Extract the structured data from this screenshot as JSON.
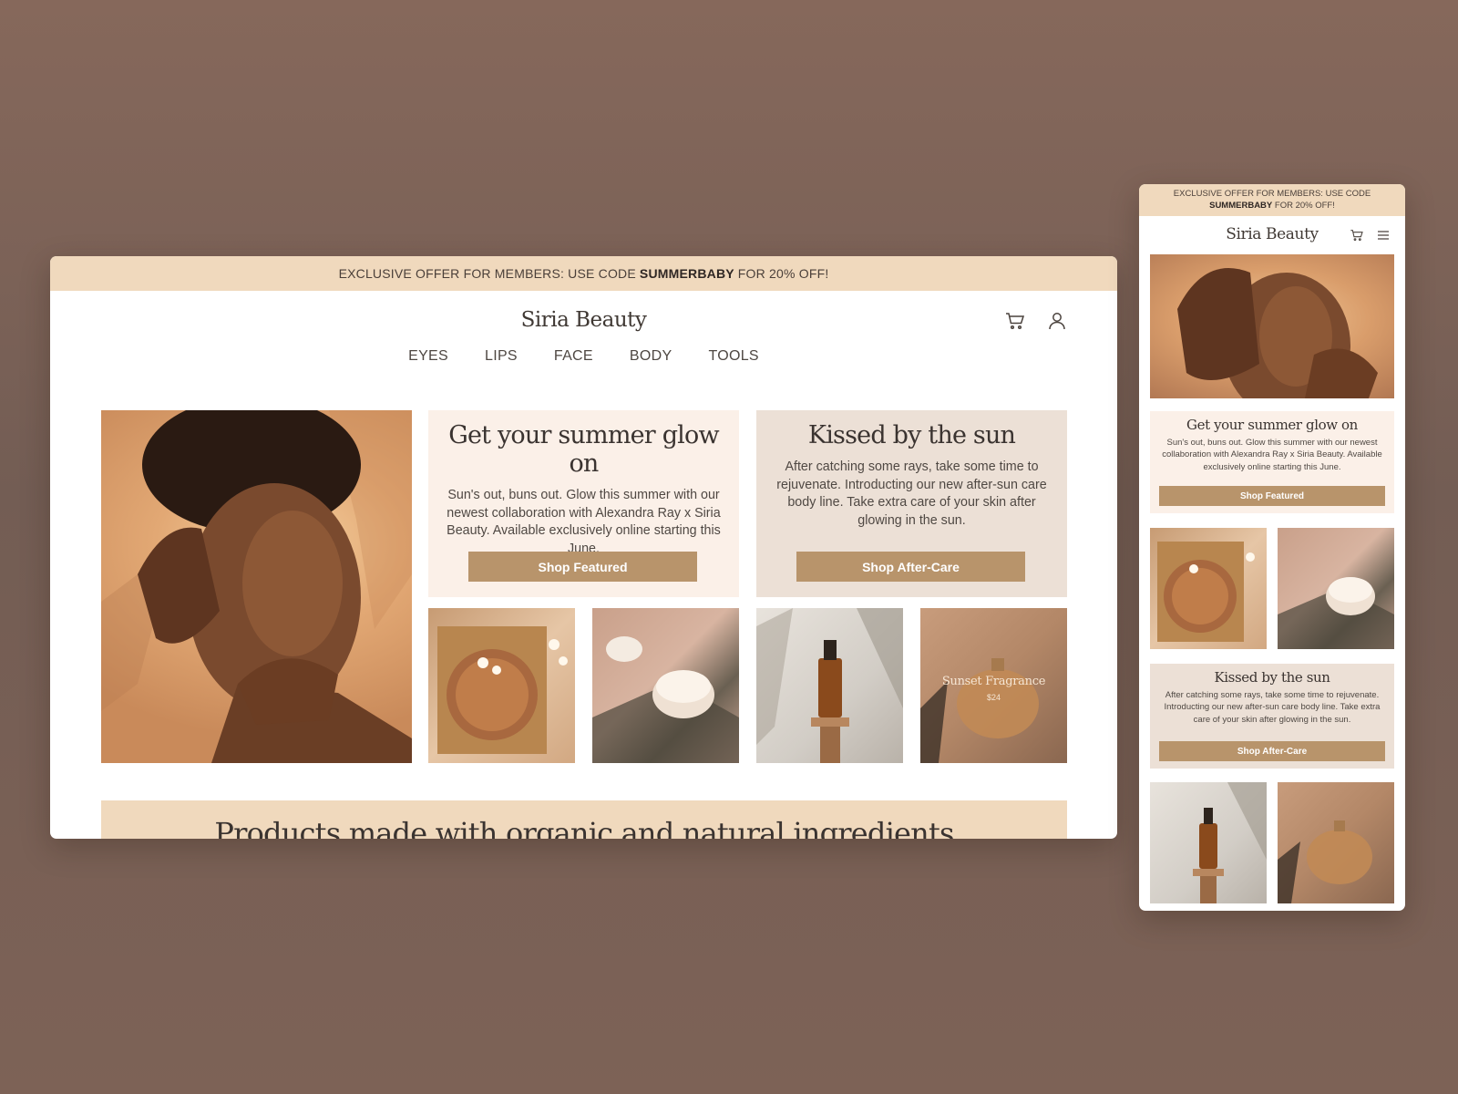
{
  "desktop": {
    "promo": {
      "prefix": "EXCLUSIVE OFFER FOR MEMBERS: USE CODE",
      "code": "SUMMERBABY",
      "suffix": "FOR 20% OFF!"
    },
    "logo": "Siria Beauty",
    "nav": [
      "EYES",
      "LIPS",
      "FACE",
      "BODY",
      "TOOLS"
    ],
    "cards": [
      {
        "title": "Get your summer glow on",
        "body": "Sun's out, buns out. Glow this summer with our newest collaboration with Alexandra Ray x Siria Beauty. Available exclusively online starting this June.",
        "button": "Shop Featured"
      },
      {
        "title": "Kissed by the sun",
        "body": "After catching some rays, take some time to rejuvenate. Introducting our new after-sun care body line. Take extra care of your skin after glowing in the sun.",
        "button": "Shop After-Care"
      }
    ],
    "fragrance": {
      "name": "Sunset Fragrance",
      "price": "$24"
    },
    "banner": "Products made with organic and natural ingredients"
  },
  "mobile": {
    "promo": {
      "prefix": "EXCLUSIVE OFFER FOR MEMBERS: USE CODE",
      "code": "SUMMERBABY",
      "suffix": "FOR 20% OFF!"
    },
    "logo": "Siria Beauty",
    "cards": [
      {
        "title": "Get your summer glow on",
        "body": "Sun's out, buns out. Glow this summer with our newest collaboration with Alexandra Ray x Siria Beauty. Available exclusively online starting this June.",
        "button": "Shop Featured"
      },
      {
        "title": "Kissed by the sun",
        "body": "After catching some rays, take some time to rejuvenate. Introducting our new after-sun care body line. Take extra care of your skin after glowing in the sun.",
        "button": "Shop After-Care"
      }
    ]
  },
  "icons": {
    "cart": "cart-icon",
    "account": "user-icon",
    "menu": "hamburger-menu-icon"
  },
  "colors": {
    "promo_bg": "#f0d9bd",
    "button": "#b8946b",
    "card_light": "#fbf0e8",
    "card_dark": "#ece0d6"
  }
}
